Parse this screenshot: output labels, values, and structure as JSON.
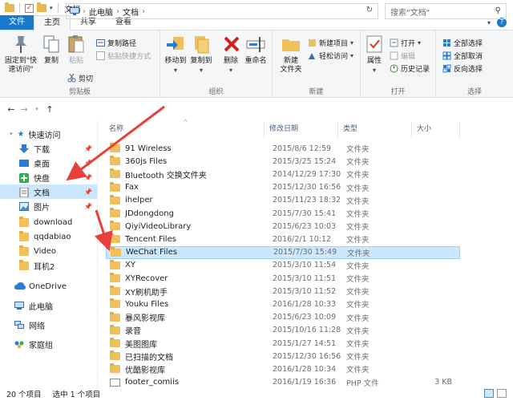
{
  "window": {
    "title": "文档"
  },
  "tabs": {
    "file": "文件",
    "home": "主页",
    "share": "共享",
    "view": "查看"
  },
  "ribbon": {
    "clipboard": {
      "label": "剪贴板",
      "pin_quick": "固定到\"快\n速访问\"",
      "copy": "复制",
      "paste": "粘贴",
      "copy_path": "复制路径",
      "paste_shortcut": "粘贴快捷方式",
      "cut": "剪切"
    },
    "organize": {
      "label": "组织",
      "move_to": "移动到",
      "copy_to": "复制到",
      "delete": "删除",
      "rename": "重命名"
    },
    "new": {
      "label": "新建",
      "new_folder": "新建\n文件夹",
      "new_item": "新建项目",
      "easy_access": "轻松访问"
    },
    "open": {
      "label": "打开",
      "properties": "属性",
      "open": "打开",
      "edit": "编辑",
      "history": "历史记录"
    },
    "select": {
      "label": "选择",
      "select_all": "全部选择",
      "select_none": "全部取消",
      "invert": "反向选择"
    }
  },
  "address": {
    "crumbs": [
      "此电脑",
      "文档"
    ],
    "search_placeholder": "搜索\"文档\""
  },
  "nav": {
    "quick_access": "快速访问",
    "items": [
      {
        "label": "下载",
        "pinned": true
      },
      {
        "label": "桌面",
        "pinned": true
      },
      {
        "label": "快盘",
        "pinned": true
      },
      {
        "label": "文档",
        "pinned": true
      },
      {
        "label": "图片",
        "pinned": true
      },
      {
        "label": "download",
        "pinned": false
      },
      {
        "label": "qqdabiao",
        "pinned": false
      },
      {
        "label": "Video",
        "pinned": false
      },
      {
        "label": "耳机2",
        "pinned": false
      }
    ],
    "onedrive": "OneDrive",
    "this_pc": "此电脑",
    "network": "网络",
    "homegroup": "家庭组"
  },
  "columns": {
    "name": "名称",
    "date": "修改日期",
    "type": "类型",
    "size": "大小"
  },
  "files": [
    {
      "name": "91 Wireless",
      "date": "2015/8/6 12:59",
      "type": "文件夹",
      "size": ""
    },
    {
      "name": "360js Files",
      "date": "2015/3/25 15:24",
      "type": "文件夹",
      "size": ""
    },
    {
      "name": "Bluetooth 交换文件夹",
      "date": "2014/12/29 17:30",
      "type": "文件夹",
      "size": ""
    },
    {
      "name": "Fax",
      "date": "2015/12/30 16:56",
      "type": "文件夹",
      "size": ""
    },
    {
      "name": "ihelper",
      "date": "2015/11/23 18:32",
      "type": "文件夹",
      "size": ""
    },
    {
      "name": "JDdongdong",
      "date": "2015/7/30 15:41",
      "type": "文件夹",
      "size": ""
    },
    {
      "name": "QiyiVideoLibrary",
      "date": "2015/6/23 10:03",
      "type": "文件夹",
      "size": ""
    },
    {
      "name": "Tencent Files",
      "date": "2016/2/1 10:12",
      "type": "文件夹",
      "size": ""
    },
    {
      "name": "WeChat Files",
      "date": "2015/7/30 15:49",
      "type": "文件夹",
      "size": ""
    },
    {
      "name": "XY",
      "date": "2015/3/10 11:54",
      "type": "文件夹",
      "size": ""
    },
    {
      "name": "XYRecover",
      "date": "2015/3/10 11:51",
      "type": "文件夹",
      "size": ""
    },
    {
      "name": "XY刷机助手",
      "date": "2015/3/10 11:52",
      "type": "文件夹",
      "size": ""
    },
    {
      "name": "Youku Files",
      "date": "2016/1/28 10:33",
      "type": "文件夹",
      "size": ""
    },
    {
      "name": "暴风影视库",
      "date": "2015/6/23 10:09",
      "type": "文件夹",
      "size": ""
    },
    {
      "name": "录音",
      "date": "2015/10/16 11:28",
      "type": "文件夹",
      "size": ""
    },
    {
      "name": "美图图库",
      "date": "2015/1/27 14:51",
      "type": "文件夹",
      "size": ""
    },
    {
      "name": "已扫描的文档",
      "date": "2015/12/30 16:56",
      "type": "文件夹",
      "size": ""
    },
    {
      "name": "优酷影视库",
      "date": "2016/1/28 10:34",
      "type": "文件夹",
      "size": ""
    },
    {
      "name": "footer_comiis",
      "date": "2016/1/19 16:36",
      "type": "PHP 文件",
      "size": "3 KB"
    }
  ],
  "status": {
    "count": "20 个项目",
    "selected": "选中 1 个项目"
  },
  "colors": {
    "accent": "#1979ca",
    "selection": "#cce8ff",
    "folder": "#f0c15a",
    "annotation_arrow": "#e8413b"
  }
}
